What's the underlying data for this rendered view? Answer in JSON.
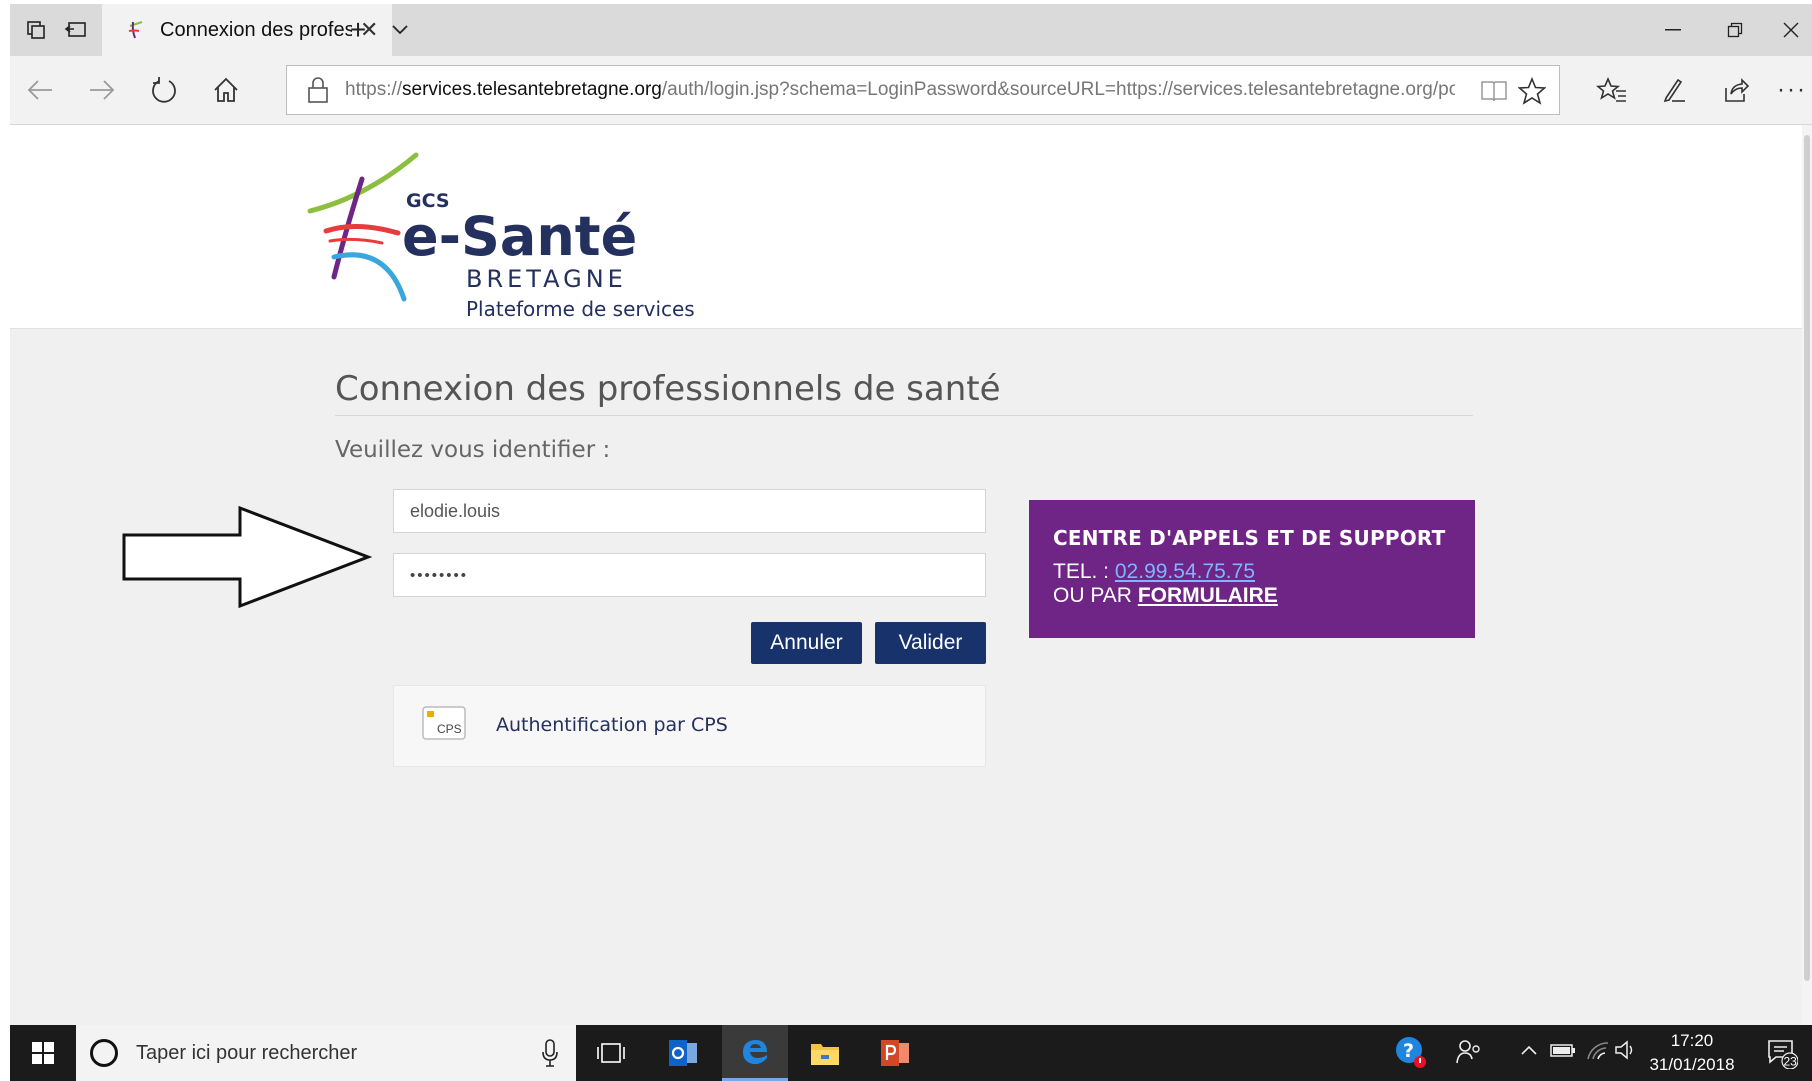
{
  "browser": {
    "tab_title": "Connexion des professi",
    "url_scheme": "https://",
    "url_domain": "services.telesantebretagne.org",
    "url_path": "/auth/login.jsp?schema=LoginPassword&sourceURL=https://services.telesantebretagne.org/portal,"
  },
  "header": {
    "logo_gcs": "GCS",
    "logo_name": "e-Santé",
    "logo_region": "BRETAGNE",
    "platform_label": "Plateforme de services"
  },
  "login": {
    "title": "Connexion des professionnels de santé",
    "subtitle": "Veuillez vous identifier :",
    "username_value": "elodie.louis",
    "password_value": "••••••••",
    "cancel_label": "Annuler",
    "submit_label": "Valider",
    "cps_icon_text": "CPS",
    "cps_label": "Authentification par CPS"
  },
  "support": {
    "title": "CENTRE D'APPELS ET DE SUPPORT",
    "tel_prefix": "TEL. :",
    "tel_number": "02.99.54.75.75",
    "form_prefix": "OU PAR",
    "form_link": "FORMULAIRE",
    "color": "#6e2585"
  },
  "taskbar": {
    "search_placeholder": "Taper ici pour rechercher",
    "time": "17:20",
    "date": "31/01/2018",
    "notification_count": "23"
  },
  "colors": {
    "button_bg": "#18336b",
    "link": "#7fb4ff"
  }
}
